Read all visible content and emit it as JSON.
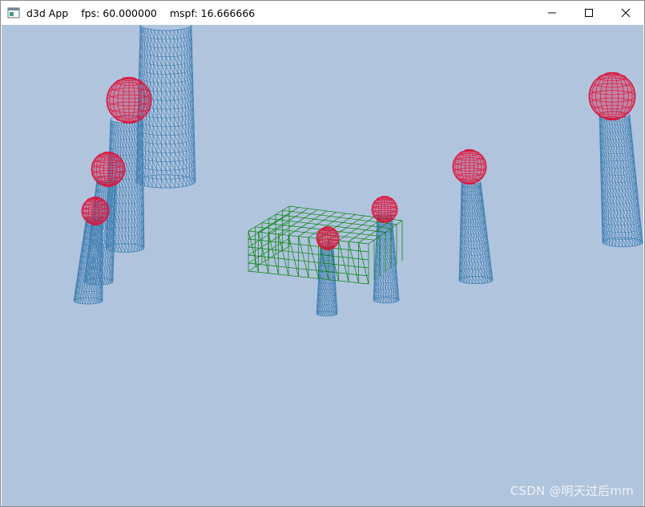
{
  "window": {
    "app_title": "d3d App",
    "fps_text": "fps: 60.000000",
    "mspf_text": "mspf: 16.666666",
    "icons": {
      "app": "window-app-icon",
      "minimize": "minimize-icon",
      "maximize": "maximize-icon",
      "close": "close-icon"
    }
  },
  "scene": {
    "background_color": "#b0c4de",
    "cylinder_color": "#4682b4",
    "sphere_color": "#dc143c",
    "box_color": "#008000"
  },
  "watermark": "CSDN @明天过后mm"
}
